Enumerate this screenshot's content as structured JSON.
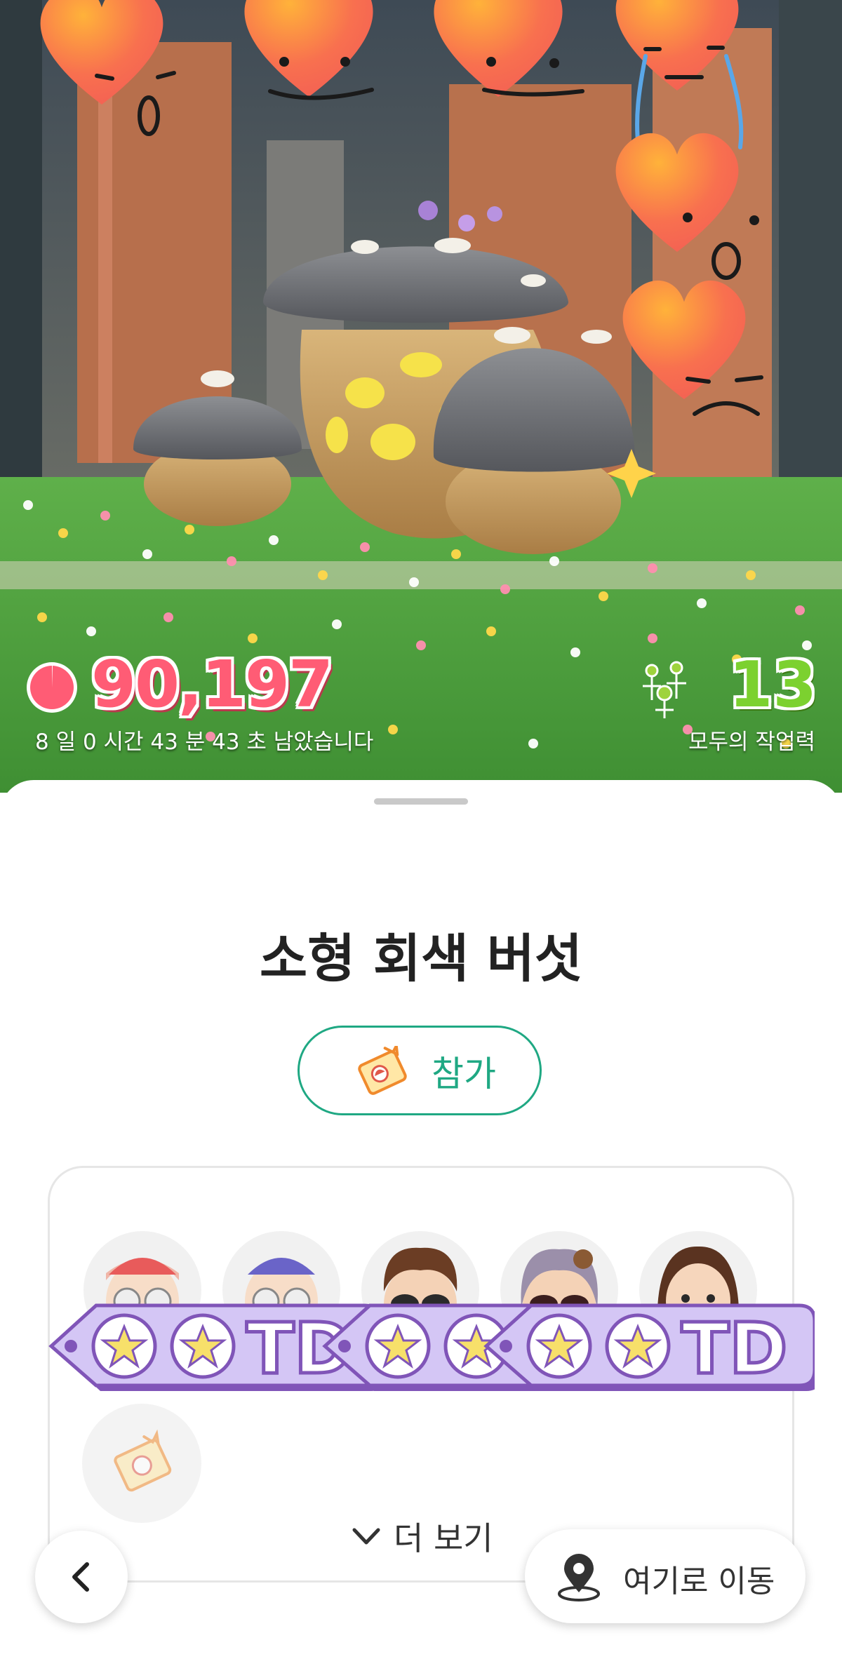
{
  "hud": {
    "energy_value": "90,197",
    "time_remaining": "8 일 0 시간 43 분 43 초 남았습니다",
    "worker_count": "13",
    "worker_label": "모두의 작업력"
  },
  "sheet": {
    "title": "소형 회색 버섯",
    "join_label": "참가",
    "more_label": "더 보기"
  },
  "stickers": {
    "tag_text": "TD"
  },
  "bottom": {
    "navigate_label": "여기로 이동"
  },
  "icons": {
    "timer": "pie-timer-icon",
    "workers": "pikmin-icon",
    "ticket": "mushroom-ticket-icon",
    "more": "chevron-down-icon",
    "back": "chevron-left-icon",
    "navigate": "location-pin-icon"
  },
  "colors": {
    "accent": "#1fa883",
    "energy": "#ff5c75",
    "worker": "#7cd12f",
    "heart": "#f76653",
    "tag_fill": "#d4c6f5",
    "tag_border": "#8055b8"
  }
}
